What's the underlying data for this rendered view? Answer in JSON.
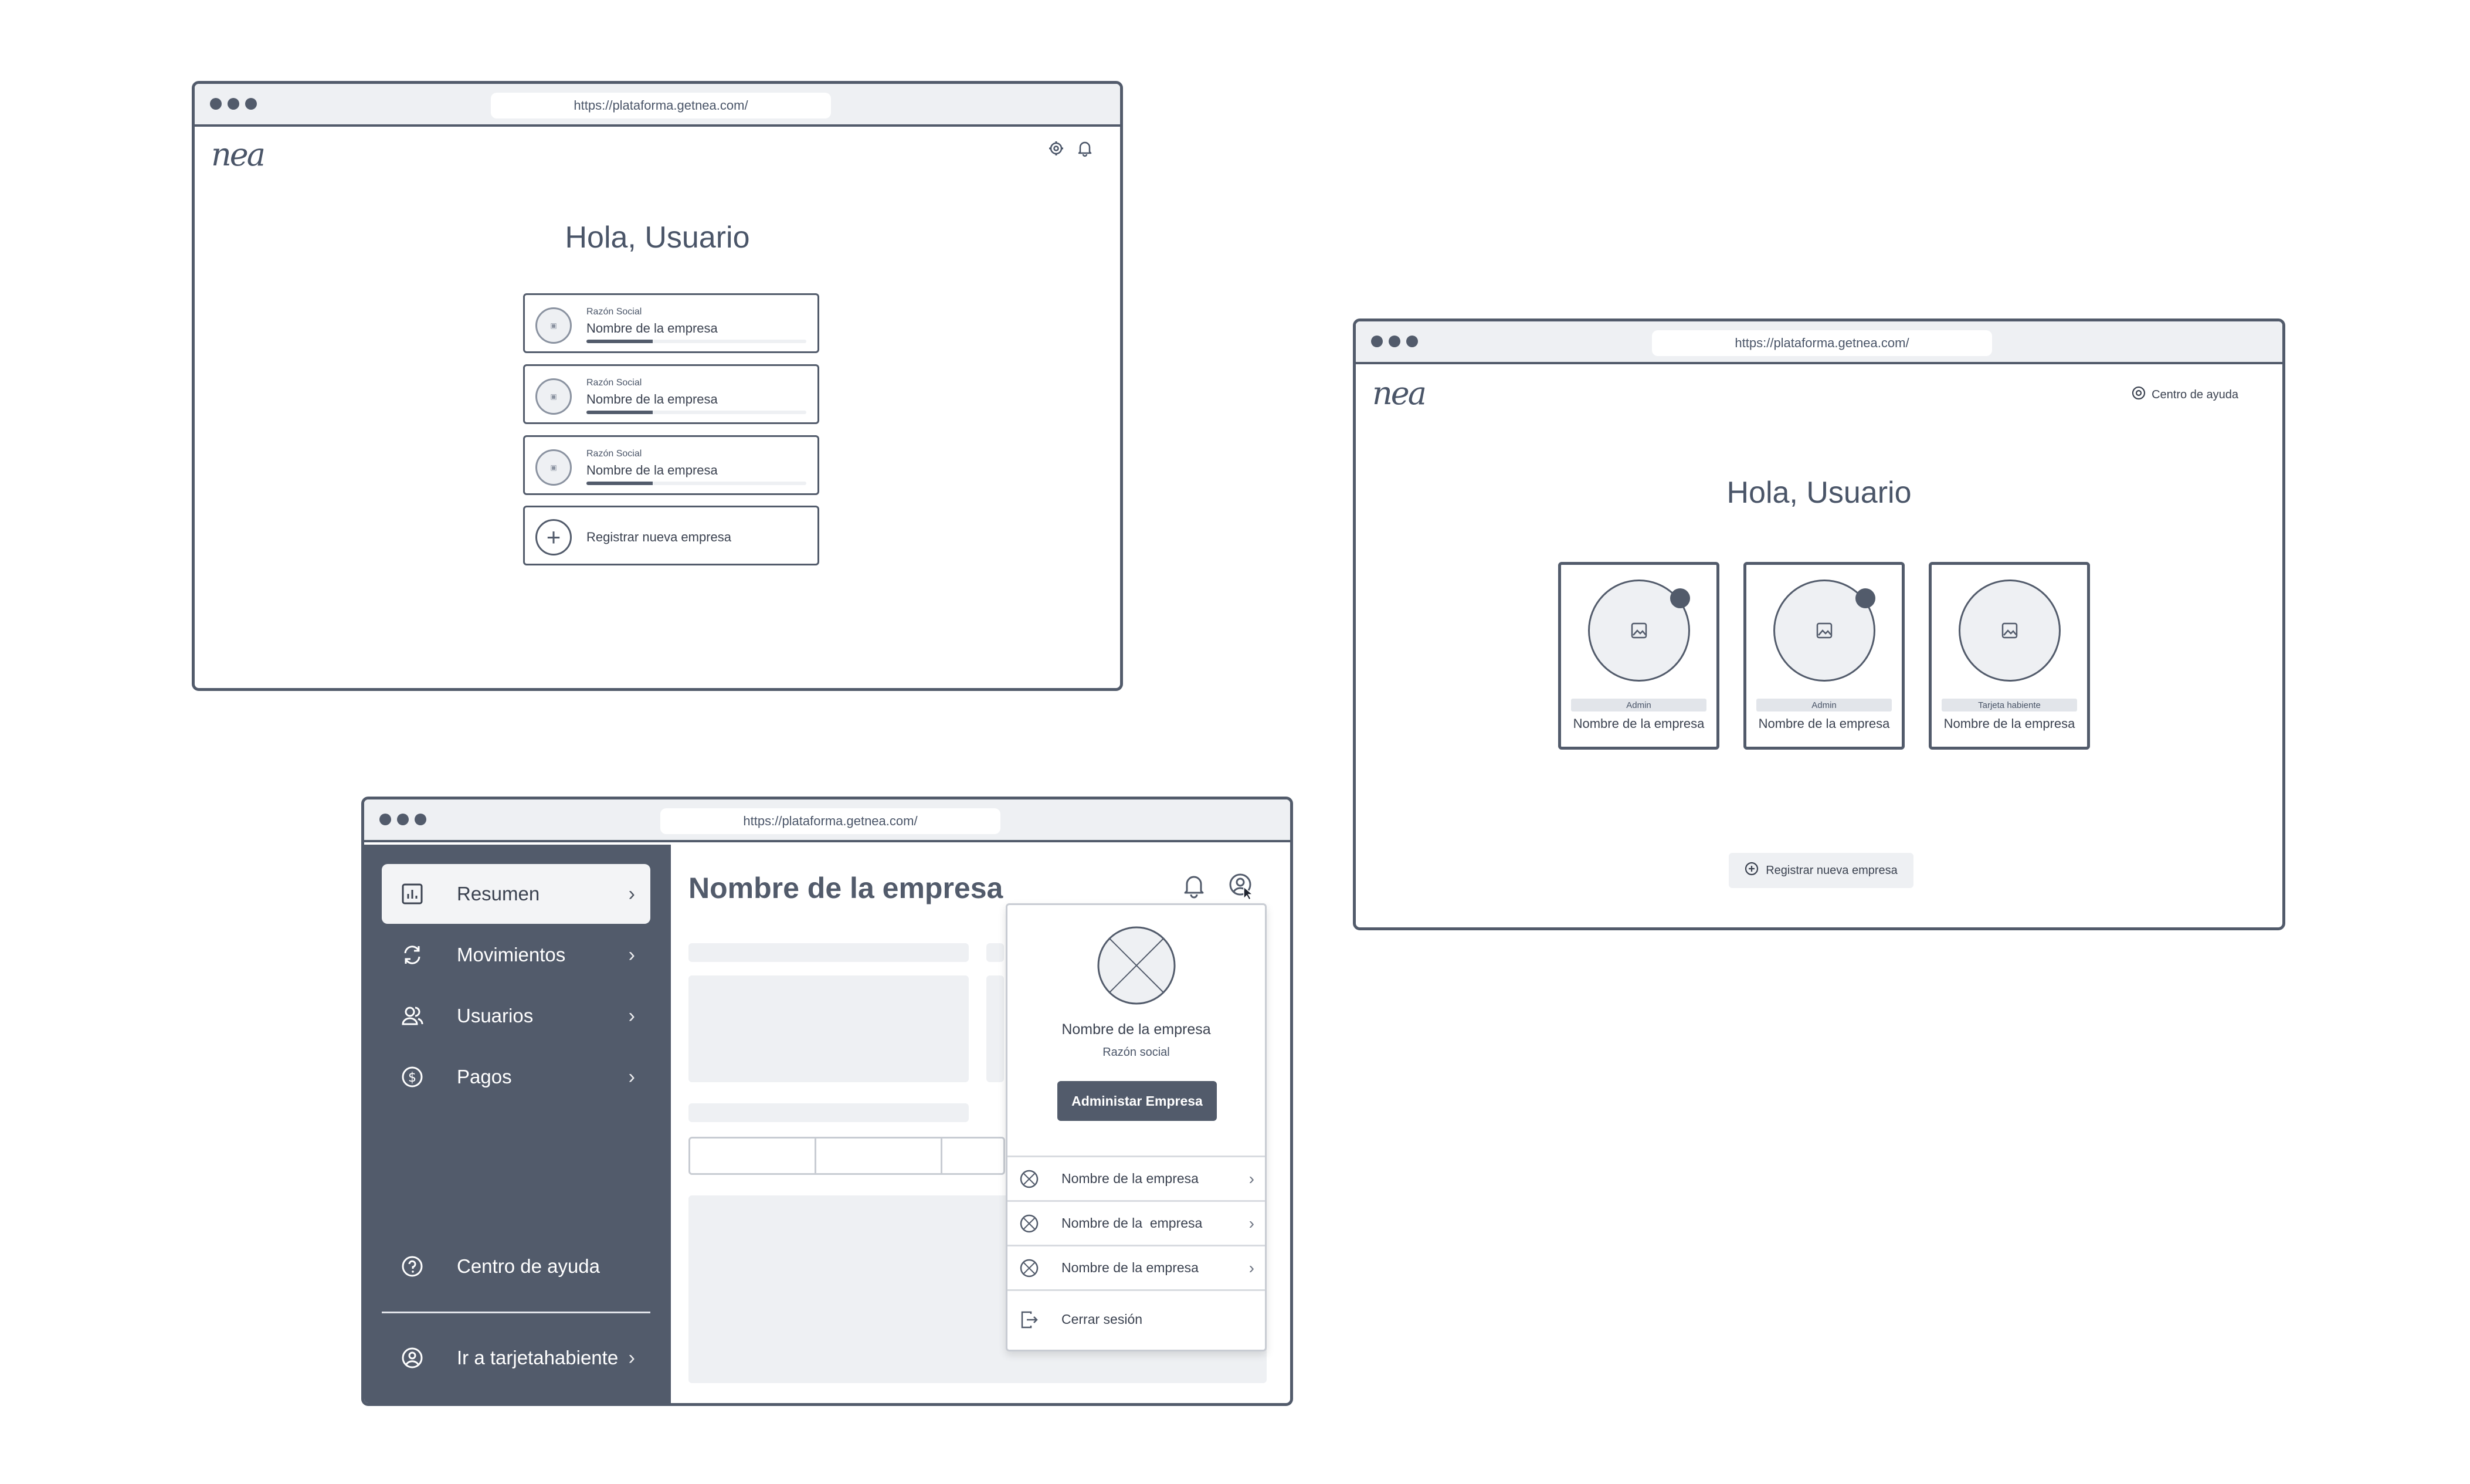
{
  "window_top_left": {
    "url": "https://plataforma.getnea.com/",
    "logo": "nea",
    "greeting": "Hola, Usuario",
    "companies": [
      {
        "label": "Razón Social",
        "name": "Nombre de la empresa",
        "progress": 0.3
      },
      {
        "label": "Razón Social",
        "name": "Nombre de la empresa",
        "progress": 0.3
      },
      {
        "label": "Razón Social",
        "name": "Nombre de la empresa",
        "progress": 0.3
      }
    ],
    "register_label": "Registrar nueva empresa"
  },
  "window_right": {
    "url": "https://plataforma.getnea.com/",
    "logo": "nea",
    "help_label": "Centro de ayuda",
    "greeting": "Hola, Usuario",
    "companies": [
      {
        "role": "Admin",
        "name": "Nombre de la empresa",
        "notification": true
      },
      {
        "role": "Admin",
        "name": "Nombre de la empresa",
        "notification": true
      },
      {
        "role": "Tarjeta habiente",
        "name": "Nombre de la empresa",
        "notification": false
      }
    ],
    "register_label": "Registrar nueva empresa"
  },
  "window_dashboard": {
    "url": "https://plataforma.getnea.com/",
    "title": "Nombre de la empresa",
    "sidebar": {
      "items": [
        {
          "label": "Resumen",
          "icon": "chart-icon",
          "active": true
        },
        {
          "label": "Movimientos",
          "icon": "refresh-icon",
          "active": false
        },
        {
          "label": "Usuarios",
          "icon": "users-icon",
          "active": false
        },
        {
          "label": "Pagos",
          "icon": "dollar-icon",
          "active": false
        }
      ],
      "help_label": "Centro de ayuda",
      "cardholder_label": "Ir a tarjetahabiente"
    },
    "profile_menu": {
      "company_name": "Nombre de la empresa",
      "subtitle": "Razón social",
      "manage_button": "Administar Empresa",
      "companies": [
        "Nombre de la empresa",
        "Nombre de la  empresa",
        "Nombre de la empresa"
      ],
      "logout_label": "Cerrar sesión"
    }
  }
}
